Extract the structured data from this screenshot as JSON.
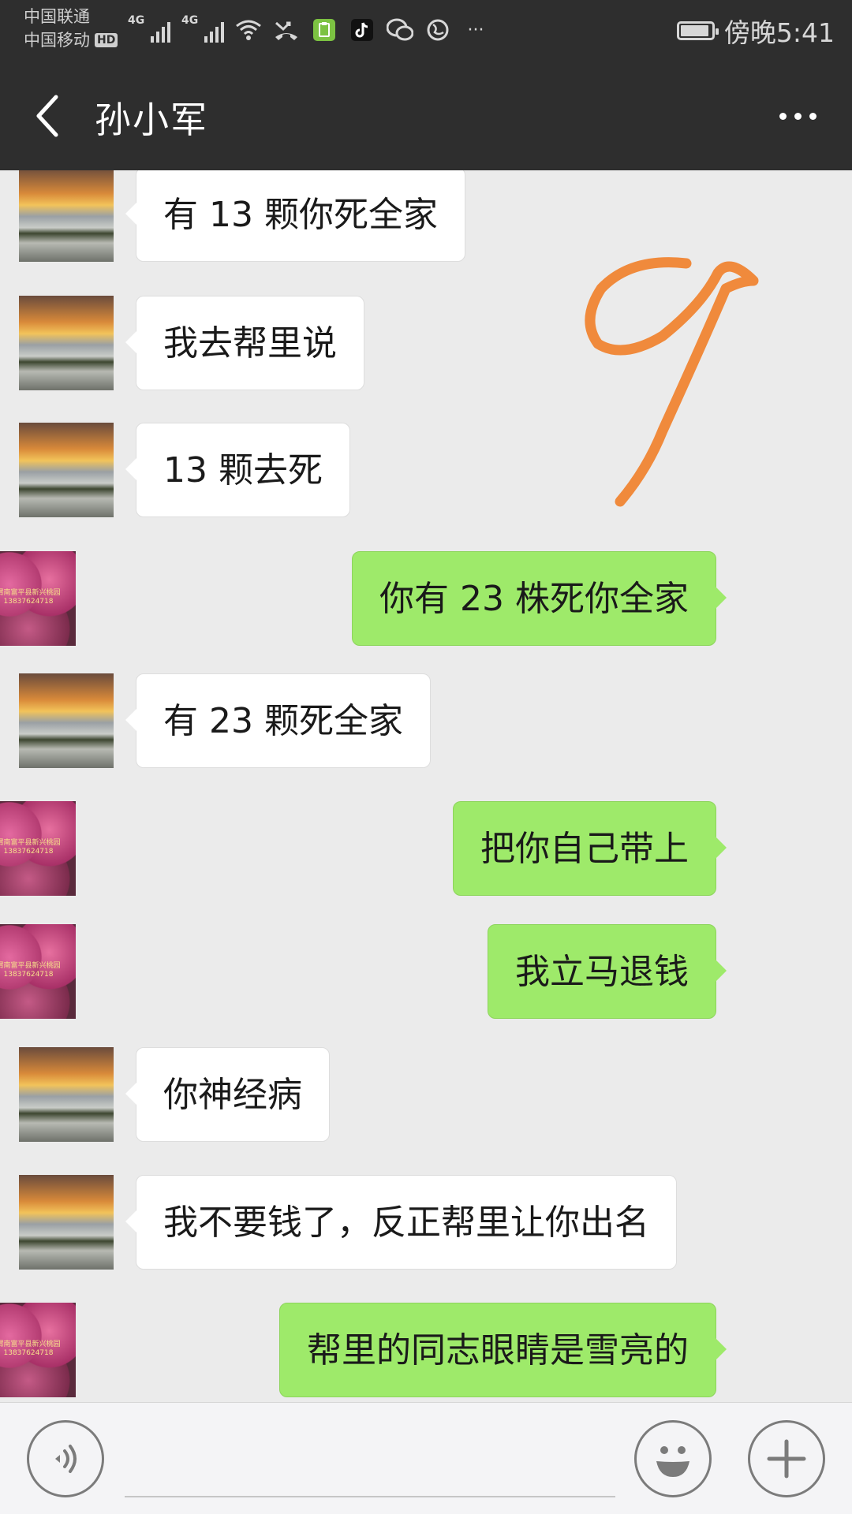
{
  "status_bar": {
    "carrier_1": "中国联通",
    "carrier_2": "中国移动",
    "hd_badge": "HD",
    "network_1": "4G",
    "network_2": "4G",
    "more_indicator": "···",
    "time": "傍晚5:41",
    "icons": [
      "signal-icon",
      "signal-icon",
      "wifi-icon",
      "missed-call-icon",
      "clipboard-app-icon",
      "tiktok-icon",
      "wechat-icon",
      "browser-icon",
      "battery-icon"
    ]
  },
  "title_bar": {
    "title": "孙小军",
    "back_icon": "chevron-left-icon",
    "more_icon": "more-dots-icon"
  },
  "messages": [
    {
      "side": "left",
      "text": "有 13 颗你死全家"
    },
    {
      "side": "left",
      "text": "我去帮里说"
    },
    {
      "side": "left",
      "text": "13 颗去死"
    },
    {
      "side": "right",
      "text": "你有 23 株死你全家"
    },
    {
      "side": "left",
      "text": "有 23 颗死全家"
    },
    {
      "side": "right",
      "text": "把你自己带上"
    },
    {
      "side": "right",
      "text": "我立马退钱"
    },
    {
      "side": "left",
      "text": "你神经病"
    },
    {
      "side": "left",
      "text": "我不要钱了，反正帮里让你出名"
    },
    {
      "side": "right",
      "text": "帮里的同志眼睛是雪亮的"
    }
  ],
  "avatars": {
    "contact": "landscape-sunset-avatar",
    "self": "peach-flower-avatar",
    "self_caption": "渭南富平县新兴桃园 13837624718"
  },
  "annotation": {
    "text": "9",
    "color": "#f08a3c"
  },
  "input_bar": {
    "voice_icon": "voice-icon",
    "text_value": "",
    "emoji_icon": "emoji-icon",
    "plus_icon": "plus-icon"
  },
  "colors": {
    "header_bg": "#2e2e2e",
    "chat_bg": "#ebebeb",
    "sent_bubble": "#9eea6a",
    "received_bubble": "#ffffff"
  }
}
